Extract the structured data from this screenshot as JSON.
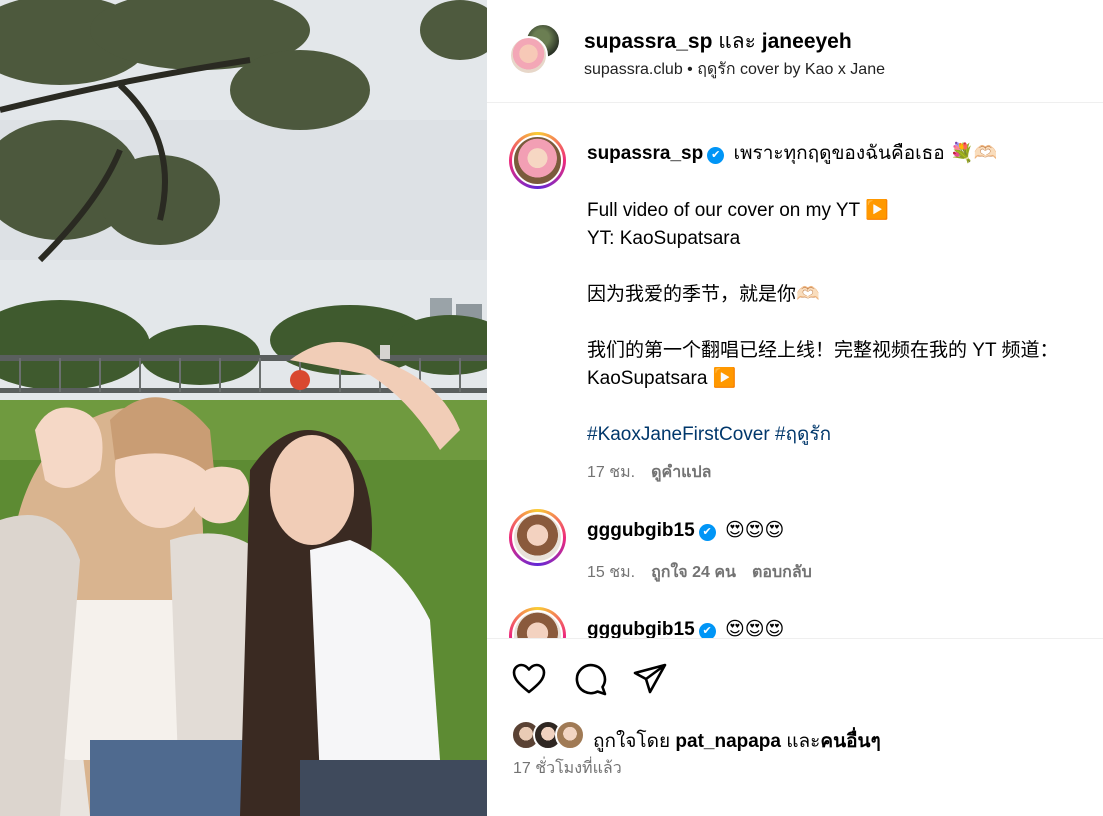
{
  "header": {
    "user1": "supassra_sp",
    "conj": "และ",
    "user2": "janeeyeh",
    "subtitle": "supassra.club • ฤดูรัก cover by Kao x Jane"
  },
  "caption": {
    "username": "supassra_sp",
    "line1": "เพราะทุกฤดูของฉันคือเธอ 💐🫶🏻",
    "line2": "Full video of our cover on my YT ▶️",
    "line3": "YT: KaoSupatsara",
    "line4": "因为我爱的季节，就是你🫶🏻",
    "line5": "我们的第一个翻唱已经上线！完整视频在我的 YT 频道：",
    "line6": "KaoSupatsara ▶️",
    "hashtags": "#KaoxJaneFirstCover #ฤดูรัก",
    "time": "17 ชม.",
    "translate": "ดูคำแปล"
  },
  "comments": [
    {
      "username": "gggubgib15",
      "text": "😍😍😍",
      "time": "15 ชม.",
      "likes": "ถูกใจ 24 คน",
      "reply": "ตอบกลับ"
    },
    {
      "username": "gggubgib15",
      "text": "😍😍😍"
    }
  ],
  "likes": {
    "prefix": "ถูกใจโดย",
    "user": "pat_napapa",
    "and": "และ",
    "others": "คนอื่นๆ"
  },
  "post_time": "17 ชั่วโมงที่แล้ว",
  "icons": {
    "like": "heart-icon",
    "comment": "comment-bubble-icon",
    "share": "paper-plane-icon",
    "verified": "verified-badge-icon"
  },
  "colors": {
    "verified": "#0095f6",
    "hashtag": "#00376b",
    "meta": "#737373"
  }
}
